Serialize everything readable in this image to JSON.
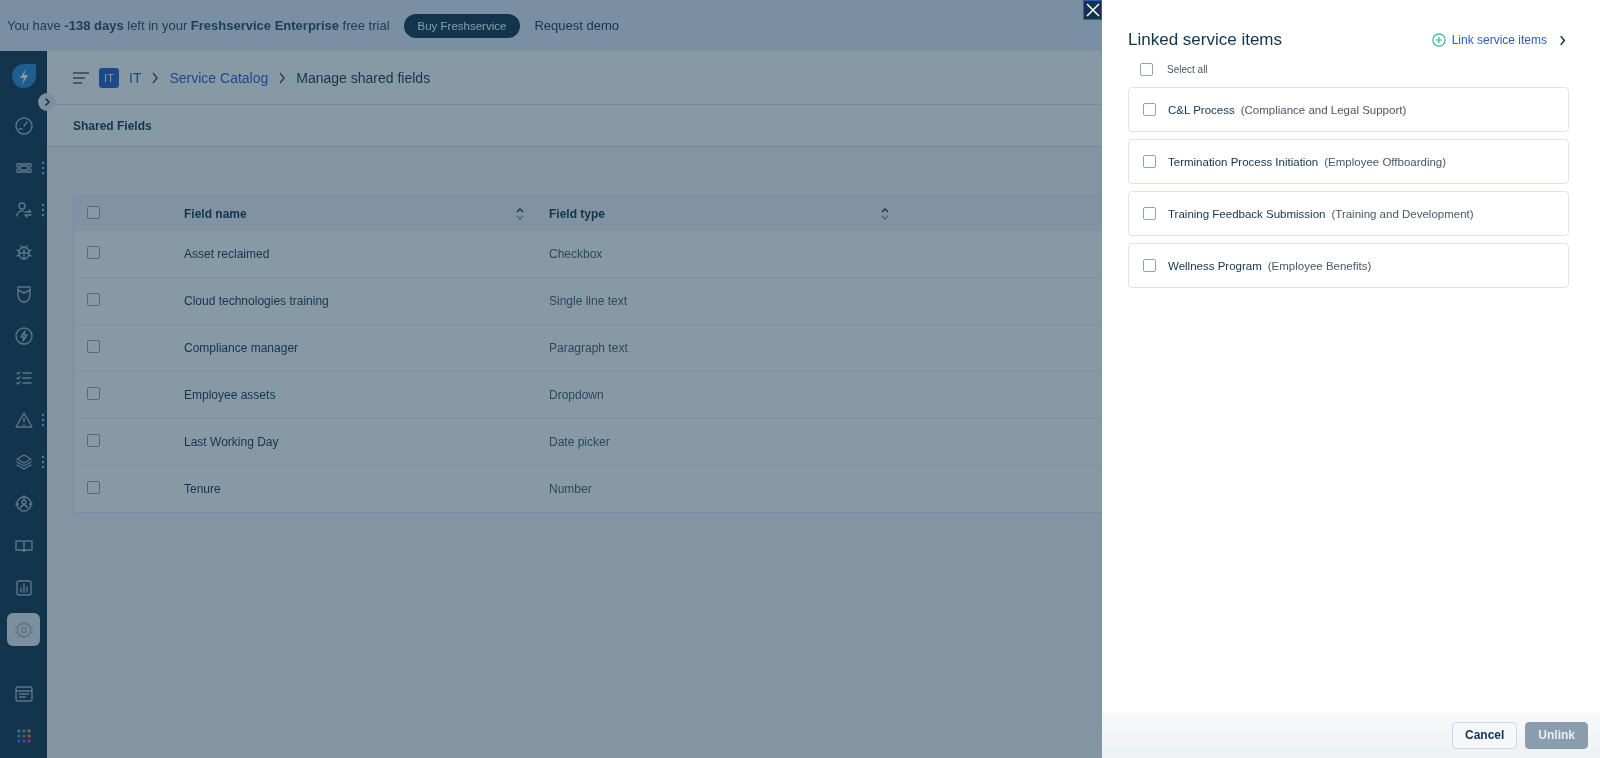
{
  "banner": {
    "message": "You have **-138 days** left in your **Freshservice Enterprise** free trial",
    "buy_button": "Buy Freshservice",
    "demo_link": "Request demo"
  },
  "sidebar": {
    "items": [
      {
        "selected": false,
        "more": false
      },
      {
        "selected": false,
        "more": true
      },
      {
        "selected": false,
        "more": true
      },
      {
        "selected": false,
        "more": false
      },
      {
        "selected": false,
        "more": false
      },
      {
        "selected": false,
        "more": false
      },
      {
        "selected": false,
        "more": false
      },
      {
        "selected": false,
        "more": true
      },
      {
        "selected": false,
        "more": true
      },
      {
        "selected": false,
        "more": false
      },
      {
        "selected": false,
        "more": false
      },
      {
        "selected": false,
        "more": false
      },
      {
        "selected": true,
        "more": false
      }
    ]
  },
  "breadcrumb": {
    "workspace_badge": "IT",
    "workspace": "IT",
    "catalog": "Service Catalog",
    "current": "Manage shared fields"
  },
  "section_title": "Shared Fields",
  "table": {
    "header_checked": false,
    "columns": [
      {
        "label": "Field name",
        "sortable": true
      },
      {
        "label": "Field type",
        "sortable": true
      }
    ],
    "rows": [
      {
        "checked": false,
        "name": "Asset reclaimed",
        "type": "Checkbox"
      },
      {
        "checked": false,
        "name": "Cloud technologies training",
        "type": "Single line text"
      },
      {
        "checked": false,
        "name": "Compliance manager",
        "type": "Paragraph text"
      },
      {
        "checked": false,
        "name": "Employee assets",
        "type": "Dropdown"
      },
      {
        "checked": false,
        "name": "Last Working Day",
        "type": "Date picker"
      },
      {
        "checked": false,
        "name": "Tenure",
        "type": "Number"
      }
    ]
  },
  "panel": {
    "title": "Linked service items",
    "link_label": "Link service items",
    "select_all": {
      "label": "Select all",
      "checked": false
    },
    "items": [
      {
        "checked": false,
        "name": "C&L Process",
        "category": "(Compliance and Legal Support)"
      },
      {
        "checked": false,
        "name": "Termination Process Initiation",
        "category": "(Employee Offboarding)"
      },
      {
        "checked": false,
        "name": "Training Feedback Submission",
        "category": "(Training and Development)"
      },
      {
        "checked": false,
        "name": "Wellness Program",
        "category": "(Employee Benefits)"
      }
    ],
    "buttons": [
      {
        "label": "Cancel",
        "kind": "secondary",
        "disabled": false
      },
      {
        "label": "Unlink",
        "kind": "primary",
        "disabled": true
      }
    ]
  }
}
